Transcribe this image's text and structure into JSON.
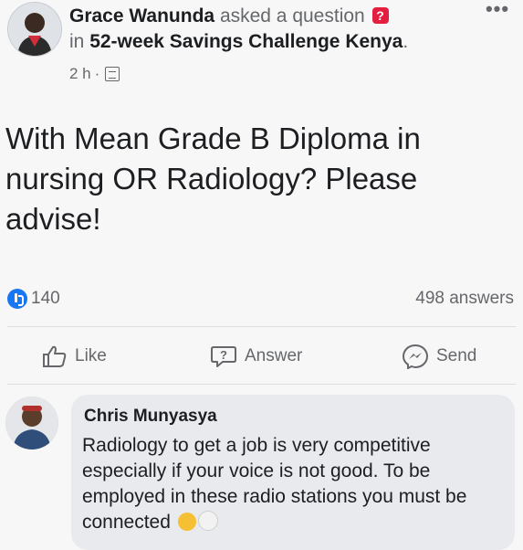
{
  "post": {
    "author": "Grace Wanunda",
    "action_text": "asked a question",
    "group_prefix": "in",
    "group": "52-week Savings Challenge Kenya",
    "group_suffix": ".",
    "time": "2 h",
    "separator": "·",
    "privacy_icon": "group-privacy-icon",
    "more_label": "•••",
    "question": "With Mean Grade B Diploma in nursing OR Radiology? Please advise!"
  },
  "stats": {
    "upvotes": "140",
    "answers": "498 answers"
  },
  "actions": {
    "like": "Like",
    "answer": "Answer",
    "send": "Send"
  },
  "comment": {
    "author": "Chris Munyasya",
    "text": "Radiology to get a job is very competitive especially if your voice is not good. To be employed in these radio stations you must be connected",
    "emojis": [
      "thinking-face",
      "rolling-eyes-face"
    ]
  },
  "colors": {
    "accent": "#1877f2",
    "question_badge": "#e41e3f",
    "muted_text": "#65676b",
    "bubble": "#e9eaed"
  }
}
